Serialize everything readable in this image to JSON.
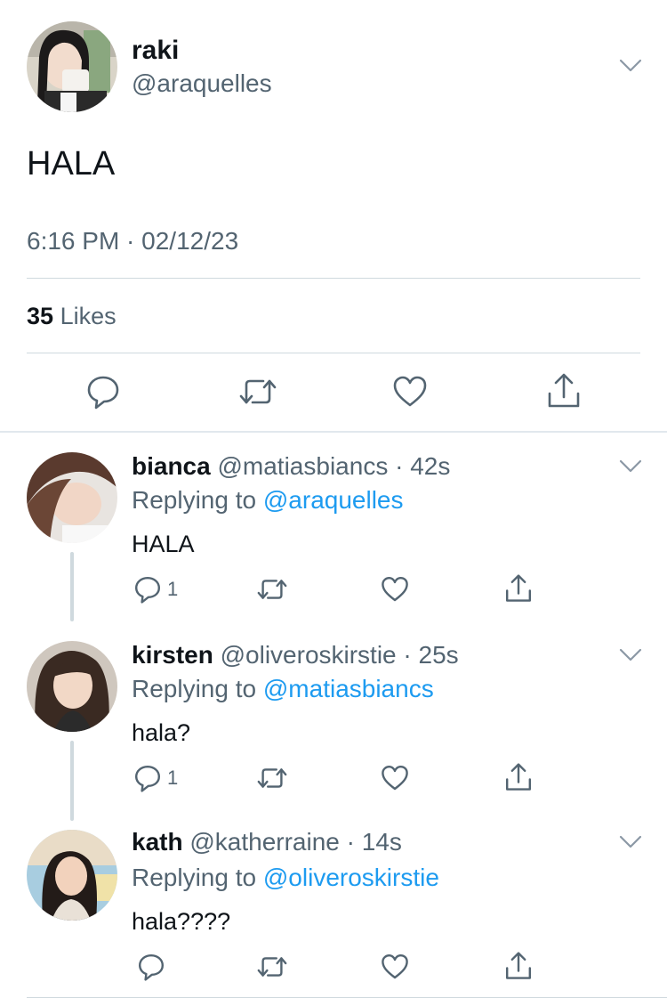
{
  "main_tweet": {
    "name": "raki",
    "handle": "@araquelles",
    "text": "HALA",
    "timestamp": "6:16 PM · 02/12/23",
    "likes_count": "35",
    "likes_label": "Likes",
    "actions": [
      "reply-icon",
      "retweet-icon",
      "like-icon",
      "share-icon"
    ]
  },
  "replies": [
    {
      "name": "bianca",
      "handle": "@matiasbiancs",
      "time": "· 42s",
      "replying_prefix": "Replying to",
      "replying_to": "@araquelles",
      "text": "HALA",
      "reply_count": "1"
    },
    {
      "name": "kirsten",
      "handle": "@oliveroskirstie",
      "time": "· 25s",
      "replying_prefix": "Replying to",
      "replying_to": "@matiasbiancs",
      "text": "hala?",
      "reply_count": "1"
    },
    {
      "name": "kath",
      "handle": "@katherraine",
      "time": "· 14s",
      "replying_prefix": "Replying to",
      "replying_to": "@oliveroskirstie",
      "text": "hala????",
      "reply_count": ""
    }
  ],
  "colors": {
    "text_primary": "#0f1419",
    "text_secondary": "#536471",
    "mention": "#1d9bf0",
    "divider": "#cfd9de"
  }
}
